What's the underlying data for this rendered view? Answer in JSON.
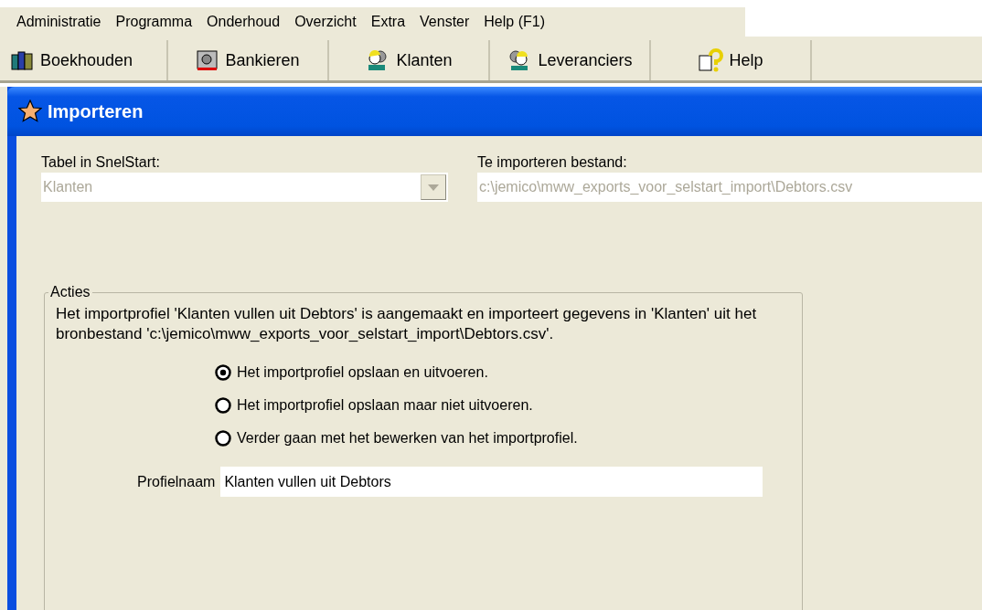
{
  "menu_bar": [
    "Administratie",
    "Programma",
    "Onderhoud",
    "Overzicht",
    "Extra",
    "Venster",
    "Help (F1)"
  ],
  "toolbar": [
    {
      "label": "Boekhouden",
      "kind": "books"
    },
    {
      "label": "Bankieren",
      "kind": "safe"
    },
    {
      "label": "Klanten",
      "kind": "customers"
    },
    {
      "label": "Leveranciers",
      "kind": "suppliers"
    },
    {
      "label": "Help",
      "kind": "help"
    }
  ],
  "dialog": {
    "title": "Importeren",
    "fields": [
      {
        "label": "Tabel in SnelStart:",
        "value": "Klanten",
        "kind": "combo",
        "disabled": true
      },
      {
        "label": "Te importeren bestand:",
        "value": "c:\\jemico\\mww_exports_voor_selstart_import\\Debtors.csv",
        "kind": "text",
        "disabled": true
      }
    ],
    "group": {
      "legend": "Acties",
      "description": "Het importprofiel 'Klanten vullen uit Debtors' is aangemaakt en importeert gegevens in 'Klanten' uit het bronbestand 'c:\\jemico\\mww_exports_voor_selstart_import\\Debtors.csv'.",
      "options": [
        {
          "label": "Het importprofiel opslaan en uitvoeren.",
          "selected": true
        },
        {
          "label": "Het importprofiel opslaan maar niet uitvoeren.",
          "selected": false
        },
        {
          "label": "Verder gaan met het bewerken van het importprofiel.",
          "selected": false
        }
      ],
      "profile": {
        "label": "Profielnaam",
        "value": "Klanten vullen uit Debtors"
      }
    }
  }
}
